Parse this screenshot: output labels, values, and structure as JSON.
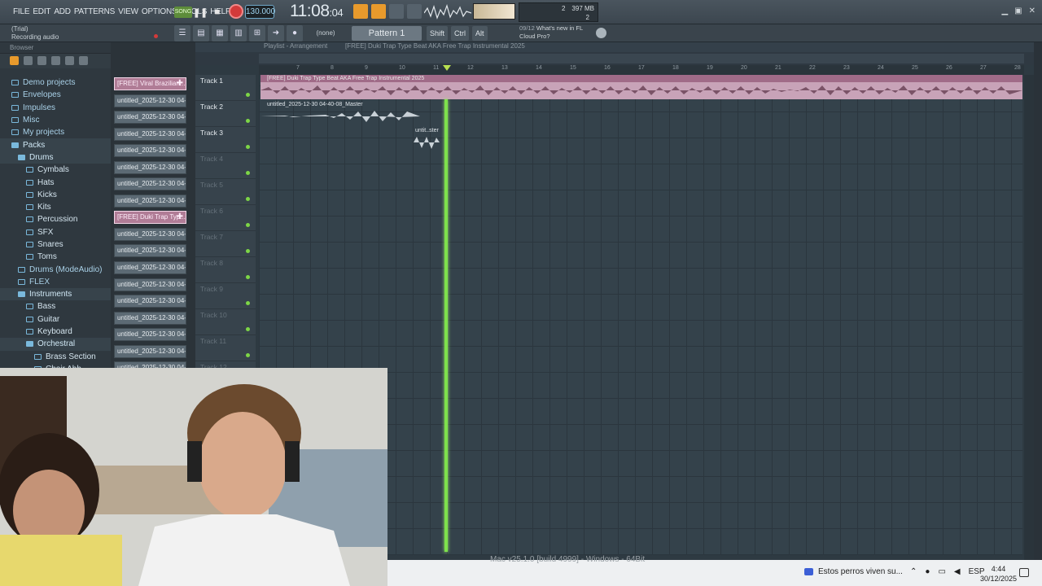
{
  "menu": [
    "FILE",
    "EDIT",
    "ADD",
    "PATTERNS",
    "VIEW",
    "OPTIONS",
    "TOOLS",
    "HELP"
  ],
  "transport": {
    "mode": "SONG",
    "tempo": "130.000",
    "time_main": "11:08",
    "time_sub": ":04"
  },
  "cpu": {
    "a": "2",
    "b": "397 MB",
    "c": "2"
  },
  "hint": {
    "line1": "(Trial)",
    "line2": "Recording audio"
  },
  "toolbar2": {
    "snap": "(none)",
    "pattern": "Pattern 1",
    "keys": [
      "Shift",
      "Ctrl",
      "Alt"
    ],
    "news_date": "09/12",
    "news_line1": "What's new in FL",
    "news_line2": "Cloud Pro?"
  },
  "browser": {
    "title": "Browser",
    "items": [
      {
        "label": "Demo projects"
      },
      {
        "label": "Envelopes"
      },
      {
        "label": "Impulses"
      },
      {
        "label": "Misc"
      },
      {
        "label": "My projects"
      },
      {
        "label": "Packs"
      },
      {
        "label": "Drums"
      },
      {
        "label": "Cymbals"
      },
      {
        "label": "Hats"
      },
      {
        "label": "Kicks"
      },
      {
        "label": "Kits"
      },
      {
        "label": "Percussion"
      },
      {
        "label": "SFX"
      },
      {
        "label": "Snares"
      },
      {
        "label": "Toms"
      },
      {
        "label": "Drums (ModeAudio)"
      },
      {
        "label": "FLEX"
      },
      {
        "label": "Instruments"
      },
      {
        "label": "Bass"
      },
      {
        "label": "Guitar"
      },
      {
        "label": "Keyboard"
      },
      {
        "label": "Orchestral"
      },
      {
        "label": "Brass Section"
      },
      {
        "label": "Choir Ahh"
      }
    ]
  },
  "channels": [
    "[FREE] Viral Brazilian...",
    "untitled_2025-12-30 04-",
    "untitled_2025-12-30 04-",
    "untitled_2025-12-30 04-",
    "untitled_2025-12-30 04-",
    "untitled_2025-12-30 04-",
    "untitled_2025-12-30 04-",
    "untitled_2025-12-30 04-",
    "[FREE] Duki Trap Typ...",
    "untitled_2025-12-30 04-",
    "untitled_2025-12-30 04-",
    "untitled_2025-12-30 04-",
    "untitled_2025-12-30 04-",
    "untitled_2025-12-30 04-",
    "untitled_2025-12-30 04-",
    "untitled_2025-12-30 04-",
    "untitled_2025-12-30 04-",
    "untitled_2025-12-30 04-"
  ],
  "playlist": {
    "title": "Playlist - Arrangement",
    "song": "[FREE] Duki Trap Type Beat AKA  Free Trap Instrumental 2025",
    "ruler": [
      "7",
      "8",
      "9",
      "10",
      "11",
      "12",
      "13",
      "14",
      "15",
      "16",
      "17",
      "18",
      "19",
      "20",
      "21",
      "22",
      "23",
      "24",
      "25",
      "26",
      "27",
      "28"
    ],
    "tracks": [
      "Track 1",
      "Track 2",
      "Track 3",
      "Track 4",
      "Track 5",
      "Track 6",
      "Track 7",
      "Track 8",
      "Track 9",
      "Track 10",
      "Track 11",
      "Track 12"
    ],
    "clips": {
      "c1": "[FREE] Duki Trap Type Beat AKA  Free Trap Instrumental 2025",
      "c2": "untitled_2025-12-30 04-40-08_Master",
      "c3": "untit..ster"
    }
  },
  "taskbar": {
    "version": "Mac v25.1.0 [build 4999] - Windows - 64Bit",
    "notification": "Estos perros viven su...",
    "lang": "ESP",
    "time": "4:44",
    "date": "30/12/2025"
  },
  "colors": {
    "accent_green": "#7ee24c",
    "clip_pink": "#c8a3b8",
    "record_red": "#d23a3a"
  }
}
